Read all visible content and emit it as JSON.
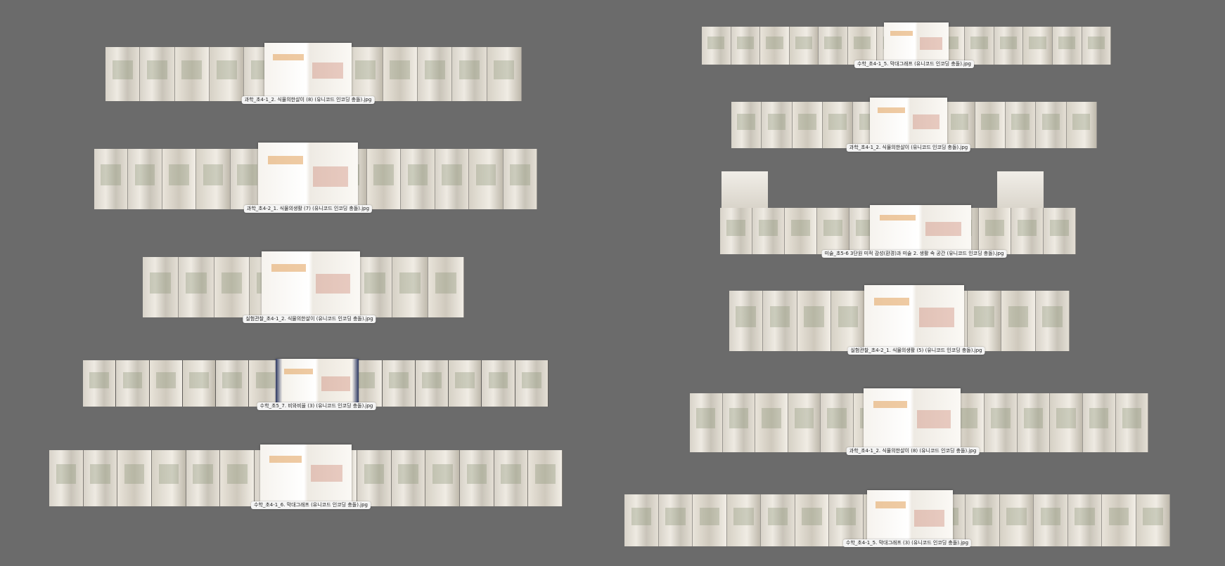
{
  "files": [
    {
      "id": "f1",
      "name": "과학_초4-1_2. 식물의한살이 (8) (유니코드 인코딩 충돌).jpg"
    },
    {
      "id": "f2",
      "name": "과학_초4-2_1. 식물의생활 (7) (유니코드 인코딩 충돌).jpg"
    },
    {
      "id": "f3",
      "name": "실험관찰_초4-1_2. 식물의한살이 (유니코드 인코딩 충돌).jpg"
    },
    {
      "id": "f4",
      "name": "수학_초5_7. 비와비율 (3) (유니코드 인코딩 충돌).jpg"
    },
    {
      "id": "f5",
      "name": "수학_초4-1_6. 막대그래프 (유니코드 인코딩 충돌).jpg"
    },
    {
      "id": "f6",
      "name": "수학_초4-1_5. 막대그래프 (유니코드 인코딩 충돌).jpg"
    },
    {
      "id": "f7",
      "name": "과학_초4-1_2. 식물의한살이 (유니코드 인코딩 충돌).jpg"
    },
    {
      "id": "f8",
      "name": "미술_초5-6 3단원 미적 감성(환경)과 미술 2. 생활 속 공간 (유니코드 인코딩 충돌).jpg"
    },
    {
      "id": "f9",
      "name": "실험관찰_초4-2_1. 식물의생활 (5) (유니코드 인코딩 충돌).jpg"
    },
    {
      "id": "f10",
      "name": "과학_초4-1_2. 식물의한살이 (8) (유니코드 인코딩 충돌).jpg"
    },
    {
      "id": "f11",
      "name": "수학_초4-1_5. 막대그래프 (3) (유니코드 인코딩 충돌).jpg"
    }
  ]
}
